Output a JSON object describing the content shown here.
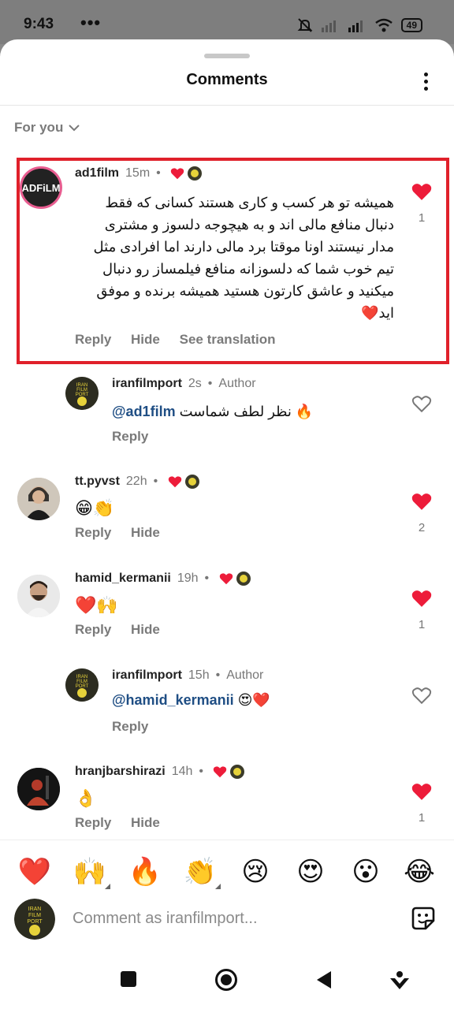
{
  "status_bar": {
    "time": "9:43",
    "dots": "•••",
    "battery": "49"
  },
  "header": {
    "title": "Comments"
  },
  "filter": {
    "label": "For you"
  },
  "comments": [
    {
      "username": "ad1film",
      "time": "15m",
      "text_lines": [
        "همیشه تو هر کسب و کاری هستند کسانی که فقط",
        "دنبال منافع مالی اند و به هیچوجه دلسوز و مشتری",
        "مدار نیستند اونا موقتا برد مالی دارند اما افرادی مثل",
        "تیم خوب شما که دلسوزانه  منافع فیلمساز رو دنبال",
        "میکنید و عاشق کارتون هستید همیشه برنده و موفق",
        "اید❤️"
      ],
      "actions": [
        "Reply",
        "Hide",
        "See translation"
      ],
      "likes": "1",
      "avatar_text": "ADFiLM",
      "reply": {
        "username": "iranfilmport",
        "time": "2s",
        "badge": "Author",
        "mention": "@ad1film",
        "text": "نظر لطف شماست 🔥",
        "action": "Reply"
      }
    },
    {
      "username": "tt.pyvst",
      "time": "22h",
      "text": "😁👏",
      "actions": [
        "Reply",
        "Hide"
      ],
      "likes": "2"
    },
    {
      "username": "hamid_kermanii",
      "time": "19h",
      "text": "❤️🙌",
      "actions": [
        "Reply",
        "Hide"
      ],
      "likes": "1",
      "reply": {
        "username": "iranfilmport",
        "time": "15h",
        "badge": "Author",
        "mention": "@hamid_kermanii",
        "text": "😍❤️",
        "action": "Reply"
      }
    },
    {
      "username": "hranjbarshirazi",
      "time": "14h",
      "text": "👌",
      "actions": [
        "Reply",
        "Hide"
      ],
      "likes": "1"
    }
  ],
  "emoji_bar": [
    "❤️",
    "🙌",
    "🔥",
    "👏",
    "😢",
    "😍",
    "😮",
    "😂"
  ],
  "composer": {
    "placeholder": "Comment as iranfilmport..."
  },
  "brand_logo_text": [
    "IRAN",
    "FILM",
    "PORT"
  ],
  "colors": {
    "highlight": "#e0202a",
    "like_red": "#ed1c3a",
    "mention": "#1f4e84"
  }
}
